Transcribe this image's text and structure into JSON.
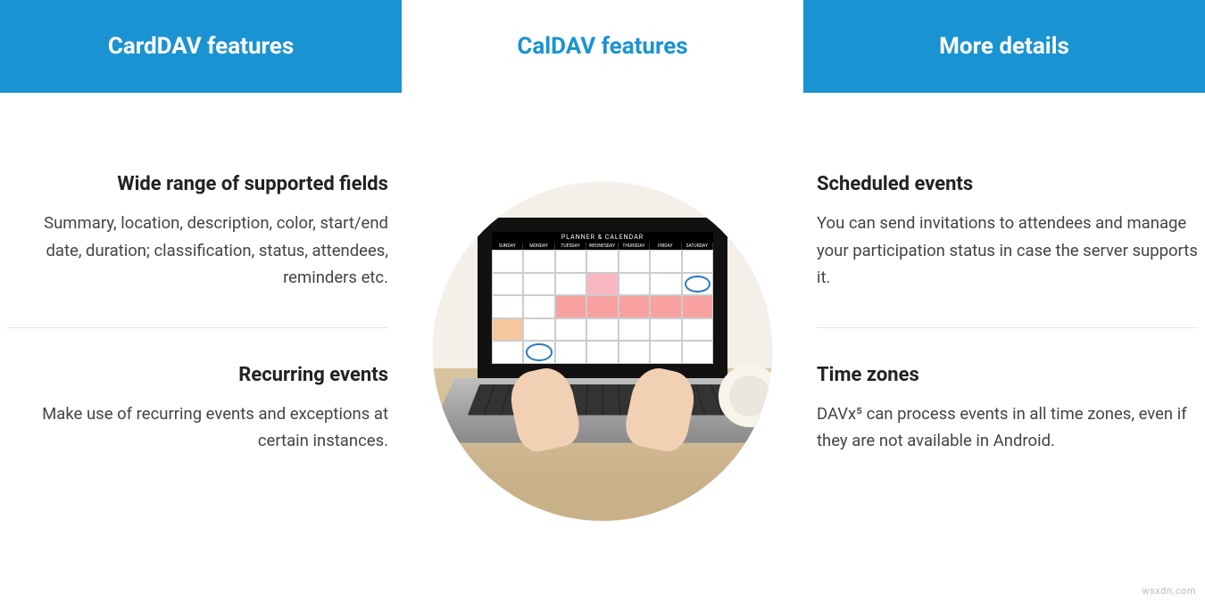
{
  "tabs": [
    {
      "label": "CardDAV features",
      "active": false
    },
    {
      "label": "CalDAV features",
      "active": true
    },
    {
      "label": "More details",
      "active": false
    }
  ],
  "left": [
    {
      "title": "Wide range of supported fields",
      "body": "Summary, location, description, color, start/end date, duration; classification, status, attendees, reminders etc."
    },
    {
      "title": "Recurring events",
      "body": "Make use of recurring events and exceptions at certain instances."
    }
  ],
  "right": [
    {
      "title": "Scheduled events",
      "body": "You can send invitations to attendees and manage your participation status in case the server supports it."
    },
    {
      "title": "Time zones",
      "body": "DAVx⁵ can process events in all time zones, even if they are not available in Android."
    }
  ],
  "center_image": {
    "alt": "Laptop showing a monthly planner calendar on a desk, hands on keyboard, coffee cup",
    "calendar_title": "PLANNER & CALENDAR",
    "days_of_week": [
      "SUNDAY",
      "MONDAY",
      "TUESDAY",
      "WEDNESDAY",
      "THURSDAY",
      "FRIDAY",
      "SATURDAY"
    ]
  },
  "watermark": "wsxdn.com"
}
